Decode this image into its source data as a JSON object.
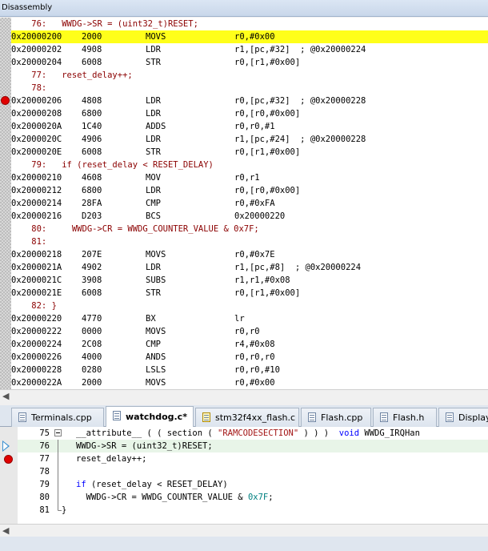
{
  "window": {
    "title": "Disassembly"
  },
  "disassembly": [
    {
      "type": "src",
      "text": "    76:   WWDG->SR = (uint32_t)RESET;"
    },
    {
      "type": "asm",
      "addr": "0x20000200",
      "hex": "2000",
      "mn": "MOVS",
      "op": "r0,#0x00",
      "hl": true
    },
    {
      "type": "asm",
      "addr": "0x20000202",
      "hex": "4908",
      "mn": "LDR",
      "op": "r1,[pc,#32]  ; @0x20000224"
    },
    {
      "type": "asm",
      "addr": "0x20000204",
      "hex": "6008",
      "mn": "STR",
      "op": "r0,[r1,#0x00]"
    },
    {
      "type": "src",
      "text": "    77:   reset_delay++;"
    },
    {
      "type": "src",
      "text": "    78:"
    },
    {
      "type": "asm",
      "addr": "0x20000206",
      "hex": "4808",
      "mn": "LDR",
      "op": "r0,[pc,#32]  ; @0x20000228",
      "bp": true
    },
    {
      "type": "asm",
      "addr": "0x20000208",
      "hex": "6800",
      "mn": "LDR",
      "op": "r0,[r0,#0x00]"
    },
    {
      "type": "asm",
      "addr": "0x2000020A",
      "hex": "1C40",
      "mn": "ADDS",
      "op": "r0,r0,#1"
    },
    {
      "type": "asm",
      "addr": "0x2000020C",
      "hex": "4906",
      "mn": "LDR",
      "op": "r1,[pc,#24]  ; @0x20000228"
    },
    {
      "type": "asm",
      "addr": "0x2000020E",
      "hex": "6008",
      "mn": "STR",
      "op": "r0,[r1,#0x00]"
    },
    {
      "type": "src",
      "text": "    79:   if (reset_delay < RESET_DELAY)"
    },
    {
      "type": "asm",
      "addr": "0x20000210",
      "hex": "4608",
      "mn": "MOV",
      "op": "r0,r1"
    },
    {
      "type": "asm",
      "addr": "0x20000212",
      "hex": "6800",
      "mn": "LDR",
      "op": "r0,[r0,#0x00]"
    },
    {
      "type": "asm",
      "addr": "0x20000214",
      "hex": "28FA",
      "mn": "CMP",
      "op": "r0,#0xFA"
    },
    {
      "type": "asm",
      "addr": "0x20000216",
      "hex": "D203",
      "mn": "BCS",
      "op": "0x20000220"
    },
    {
      "type": "src",
      "text": "    80:     WWDG->CR = WWDG_COUNTER_VALUE & 0x7F;"
    },
    {
      "type": "src",
      "text": "    81:"
    },
    {
      "type": "asm",
      "addr": "0x20000218",
      "hex": "207E",
      "mn": "MOVS",
      "op": "r0,#0x7E"
    },
    {
      "type": "asm",
      "addr": "0x2000021A",
      "hex": "4902",
      "mn": "LDR",
      "op": "r1,[pc,#8]  ; @0x20000224"
    },
    {
      "type": "asm",
      "addr": "0x2000021C",
      "hex": "3908",
      "mn": "SUBS",
      "op": "r1,r1,#0x08"
    },
    {
      "type": "asm",
      "addr": "0x2000021E",
      "hex": "6008",
      "mn": "STR",
      "op": "r0,[r1,#0x00]"
    },
    {
      "type": "src",
      "text": "    82: }"
    },
    {
      "type": "asm",
      "addr": "0x20000220",
      "hex": "4770",
      "mn": "BX",
      "op": "lr"
    },
    {
      "type": "asm",
      "addr": "0x20000222",
      "hex": "0000",
      "mn": "MOVS",
      "op": "r0,r0"
    },
    {
      "type": "asm",
      "addr": "0x20000224",
      "hex": "2C08",
      "mn": "CMP",
      "op": "r4,#0x08"
    },
    {
      "type": "asm",
      "addr": "0x20000226",
      "hex": "4000",
      "mn": "ANDS",
      "op": "r0,r0,r0"
    },
    {
      "type": "asm",
      "addr": "0x20000228",
      "hex": "0280",
      "mn": "LSLS",
      "op": "r0,r0,#10"
    },
    {
      "type": "asm",
      "addr": "0x2000022A",
      "hex": "2000",
      "mn": "MOVS",
      "op": "r0,#0x00"
    }
  ],
  "tabs": [
    {
      "label": "Terminals.cpp",
      "icon": "file-icon"
    },
    {
      "label": "watchdog.c*",
      "icon": "file-icon",
      "active": true
    },
    {
      "label": "stm32f4xx_flash.c",
      "icon": "file-warning-icon"
    },
    {
      "label": "Flash.cpp",
      "icon": "file-icon"
    },
    {
      "label": "Flash.h",
      "icon": "file-icon"
    },
    {
      "label": "Display",
      "icon": "file-icon"
    }
  ],
  "editor": {
    "lines": [
      {
        "num": "75",
        "html_id": "l75"
      },
      {
        "num": "76",
        "html_id": "l76",
        "current": true
      },
      {
        "num": "77",
        "html_id": "l77",
        "bp": true
      },
      {
        "num": "78",
        "html_id": "l78"
      },
      {
        "num": "79",
        "html_id": "l79"
      },
      {
        "num": "80",
        "html_id": "l80"
      },
      {
        "num": "81",
        "html_id": "l81"
      }
    ],
    "code": {
      "l75_a": "__attribute__ ( ( section ( ",
      "l75_str": "\"RAMCODESECTION\"",
      "l75_b": " ) ) )  ",
      "l75_kw": "void",
      "l75_c": " WWDG_IRQHan",
      "l76": "WWDG->SR = (uint32_t)RESET;",
      "l77": "reset_delay++;",
      "l79_kw": "if",
      "l79_b": " (reset_delay < RESET_DELAY)",
      "l80_a": "  WWDG->CR = WWDG_COUNTER_VALUE & ",
      "l80_num": "0x7F",
      "l80_b": ";",
      "l81": "}"
    }
  },
  "colors": {
    "highlight": "#ffff1a",
    "breakpoint": "#e00000",
    "source_line": "#8b0000",
    "keyword": "#0000ff",
    "string": "#a31515",
    "number": "#008080"
  }
}
